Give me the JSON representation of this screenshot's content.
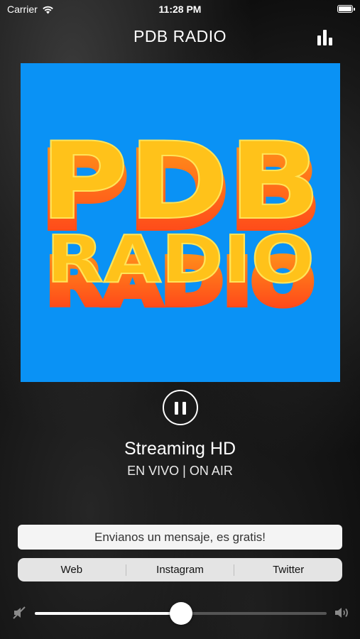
{
  "status_bar": {
    "carrier": "Carrier",
    "time": "11:28 PM",
    "icons": [
      "wifi-icon",
      "battery-icon"
    ]
  },
  "header": {
    "title": "PDB RADIO",
    "right_icon": "equalizer-icon"
  },
  "artwork": {
    "line1": "PDB",
    "line2": "RADIO",
    "background_color": "#0a92f5",
    "text_color": "#ffc21a"
  },
  "player": {
    "state_icon": "pause-icon",
    "title": "Streaming HD",
    "subtitle": "EN VIVO | ON AIR"
  },
  "message": {
    "label": "Envianos un mensaje, es gratis!"
  },
  "links": [
    {
      "label": "Web"
    },
    {
      "label": "Instagram"
    },
    {
      "label": "Twitter"
    }
  ],
  "volume": {
    "level": 0.5,
    "min_icon": "volume-mute-icon",
    "max_icon": "volume-high-icon"
  }
}
